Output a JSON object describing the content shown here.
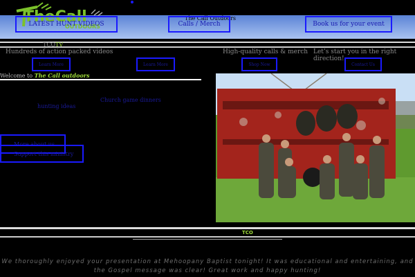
{
  "header": {
    "logo_text": "TheCall",
    "logo_sub": "OUTDOORS",
    "site_name": "The Call Outdoors",
    "nav": [
      {
        "label": "LATEST HUNT VIDEOS"
      },
      {
        "label": "Calls / Merch"
      },
      {
        "label": "Book us for your event"
      }
    ]
  },
  "tco_tv": {
    "prefix": "TCO",
    "suffix": "TV"
  },
  "taglines": {
    "videos": "Hundreds of action packed videos",
    "calls": "High-quality calls & merch",
    "event": "Let’s start you in the right direction!"
  },
  "small_buttons": [
    {
      "label": "Learn More"
    },
    {
      "label": "Learn More"
    },
    {
      "label": "Shop Now"
    },
    {
      "label": "Contact Us"
    }
  ],
  "welcome": {
    "prefix": "Welcome to ",
    "brand": "The Call outdoors"
  },
  "links": {
    "hunting_ideas": "hunting ideas",
    "church_game_dinners": "Church game dinners"
  },
  "buttons": {
    "more_about_us": "More about us",
    "support_ministry": "Support this ministry"
  },
  "photo": {
    "alt": "Hunting group in front of red trailer with turkeys"
  },
  "section_title": "TCO",
  "testimonial": "We thoroughly enjoyed your presentation at Mehoopany Baptist tonight! It was educational and entertaining, and the Gospel message was clear! Great work and happy hunting!",
  "colors": {
    "accent_green": "#9fdc3a",
    "link_blue": "#1a1aff",
    "sky_top": "#5b83d6"
  }
}
